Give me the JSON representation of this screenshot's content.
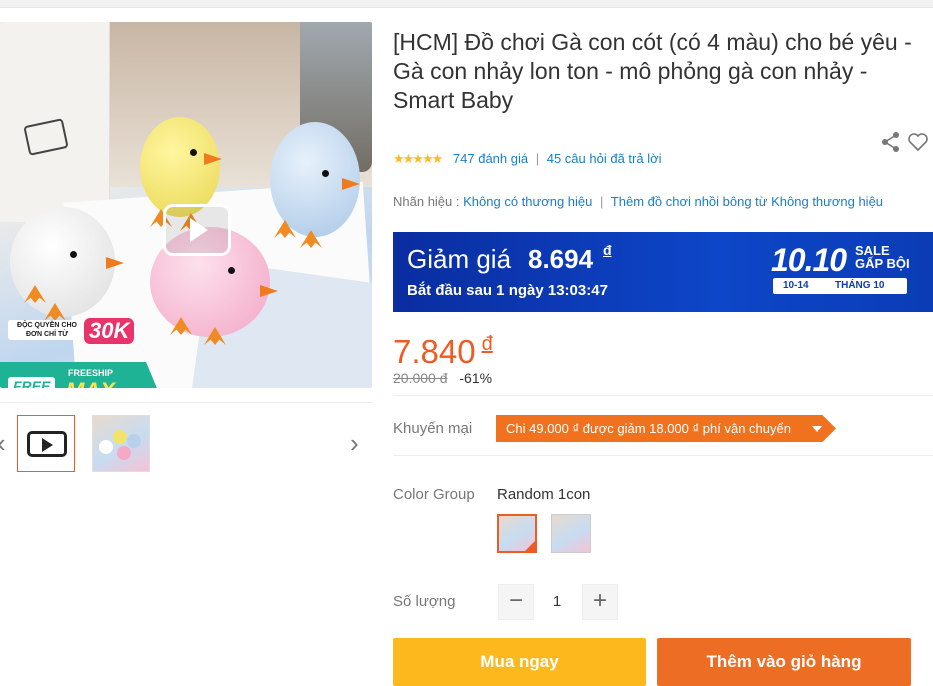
{
  "gallery": {
    "badge_small": "ĐỘC QUYỀN CHO ĐƠN CHỈ TỪ",
    "badge_big": "30K",
    "free_label": "FREE",
    "freeship_label": "FREESHIP",
    "max_label": "MAX",
    "prev_arrow": "‹",
    "next_arrow": "›"
  },
  "product": {
    "title": "[HCM] Đồ chơi Gà con cót (có 4 màu) cho bé yêu - Gà con nhảy lon ton - mô phỏng gà con nhảy - Smart Baby",
    "stars": "★★★★★",
    "rating_count": "747 đánh giá",
    "questions": "45 câu hỏi đã trả lời",
    "brand_label": "Nhãn hiệu :",
    "brand_value": "Không có thương hiệu",
    "category_link": "Thêm đồ chơi nhồi bông từ Không thương hiệu"
  },
  "flash_sale": {
    "label": "Giảm giá",
    "amount": "8.694",
    "currency": "đ",
    "start_text": "Bắt đầu sau 1 ngày 13:03:47",
    "logo": "10.10",
    "sale_line1": "SALE",
    "sale_line2": "GẤP BỘI",
    "date_range": "10-14",
    "month": "THÁNG 10"
  },
  "pricing": {
    "price": "7.840",
    "currency": "đ",
    "old_price": "20.000 đ",
    "discount": "-61%"
  },
  "promo": {
    "label": "Khuyến mại",
    "text": "Chi 49.000 ₫ được giảm 18.000 ₫ phí vận chuyển"
  },
  "variant": {
    "label": "Color Group",
    "selected": "Random 1con"
  },
  "quantity": {
    "label": "Số lượng",
    "value": "1",
    "minus": "−",
    "plus": "+"
  },
  "actions": {
    "buy_now": "Mua ngay",
    "add_to_cart": "Thêm vào giỏ hàng"
  },
  "colors": {
    "accent": "#ee5c23",
    "buy_button": "#fcb81c",
    "link": "#1b7ec4",
    "flash_bg": "#0d46c8"
  }
}
